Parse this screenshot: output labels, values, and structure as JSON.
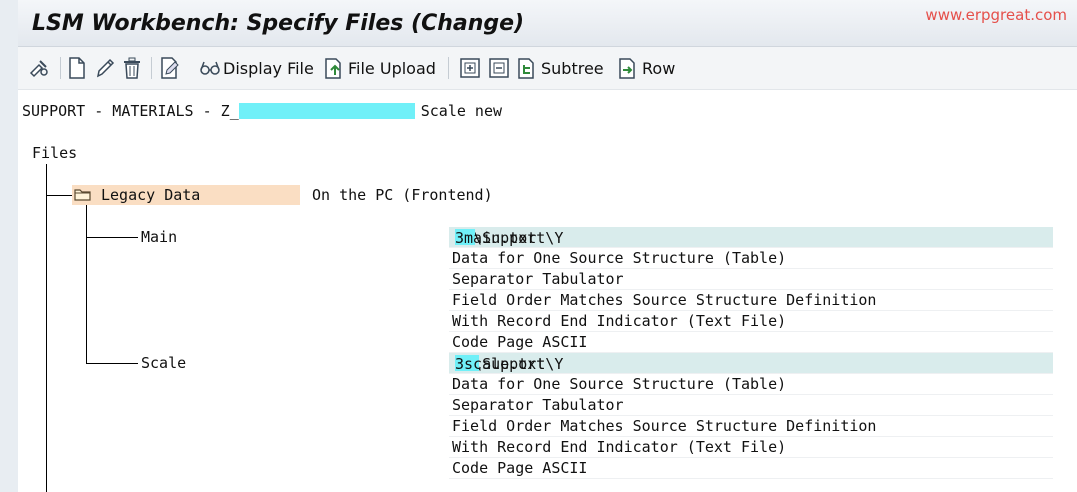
{
  "window": {
    "title": "LSM Workbench: Specify Files (Change)",
    "watermark": "www.erpgreat.com"
  },
  "toolbar": {
    "icons": [
      "toggle-display-change-icon",
      "new-file-icon",
      "edit-pencil-icon",
      "delete-trash-icon",
      "edit-document-icon",
      "glasses-icon",
      "file-upload-icon",
      "expand-icon",
      "collapse-icon",
      "subtree-icon",
      "row-icon"
    ],
    "display_file_label": "Display File",
    "file_upload_label": "File Upload",
    "subtree_label": "Subtree",
    "row_label": "Row"
  },
  "header": {
    "prefix": "SUPPORT - MATERIALS - Z_",
    "suffix": "Scale new"
  },
  "tree": {
    "root_label": "Files",
    "legacy": {
      "label": "Legacy Data",
      "location": "On the PC (Frontend)"
    },
    "files": [
      {
        "name": "Main",
        "path_prefix": "C:\\Support\\Y",
        "path_suffix": "3main.txt",
        "details": [
          "Data for One Source Structure (Table)",
          "Separator Tabulator",
          "Field Order Matches Source Structure Definition",
          "With Record End Indicator (Text File)",
          "Code Page ASCII"
        ]
      },
      {
        "name": "Scale",
        "path_prefix": "C:\\Support\\Y",
        "path_suffix": "3scale.txt",
        "details": [
          "Data for One Source Structure (Table)",
          "Separator Tabulator",
          "Field Order Matches Source Structure Definition",
          "With Record End Indicator (Text File)",
          "Code Page ASCII"
        ]
      }
    ]
  },
  "colors": {
    "legacy_highlight": "#fadec3",
    "redaction": "#70f0f8",
    "path_row_highlight": "#d9ecec",
    "watermark": "#e5504b"
  }
}
